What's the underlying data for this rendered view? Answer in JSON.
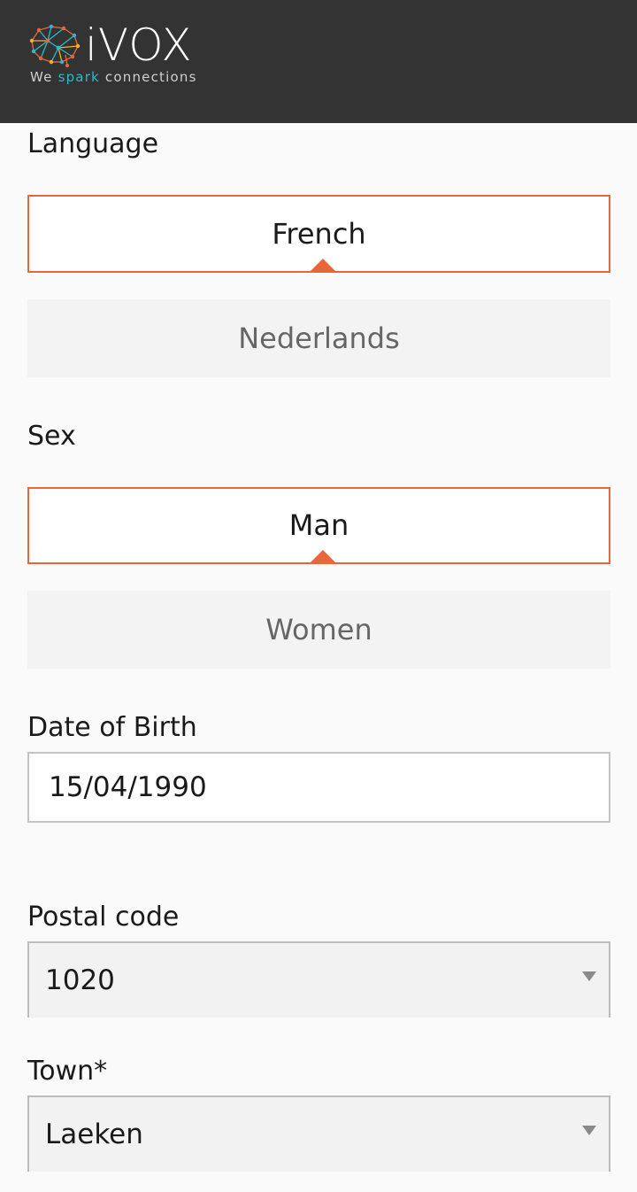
{
  "header": {
    "logo_word": "iVOX",
    "tagline_pre": "We ",
    "tagline_highlight": "spark",
    "tagline_post": " connections"
  },
  "language": {
    "label": "Language",
    "options": [
      "French",
      "Nederlands"
    ],
    "selected": "French"
  },
  "sex": {
    "label": "Sex",
    "options": [
      "Man",
      "Women"
    ],
    "selected": "Man"
  },
  "birth": {
    "label": "Date of Birth",
    "value": "15/04/1990"
  },
  "postal": {
    "label": "Postal code",
    "value": "1020"
  },
  "town": {
    "label": "Town*",
    "value": "Laeken"
  },
  "colors": {
    "header_bg": "#333333",
    "accent": "#e8673a",
    "tagline_highlight": "#2fb8c9"
  }
}
